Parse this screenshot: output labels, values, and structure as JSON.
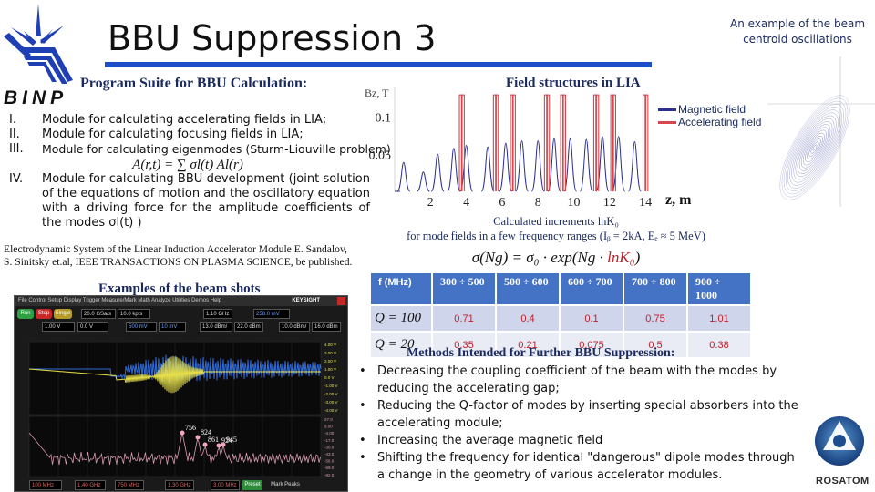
{
  "header": {
    "title": "BBU Suppression 3",
    "institute_logo_text": "BINP",
    "right_caption_line1": "An example of the beam",
    "right_caption_line2": "centroid oscillations",
    "accent_color": "#1f4fc8"
  },
  "program_suite": {
    "title": "Program Suite for BBU Calculation:",
    "modules": [
      {
        "num": "I.",
        "text": "Module for calculating accelerating fields in LIA;"
      },
      {
        "num": "II.",
        "text": "Module for calculating focusing fields in LIA;"
      },
      {
        "num": "III.",
        "text": "Module for calculating eigenmodes (Sturm-Liouville problem)",
        "formula": "A(r,t) = ∑ σl(t) Al(r)"
      },
      {
        "num": "IV.",
        "text": "Module for calculating BBU development (joint solution of the equations of motion and the oscillatory equation with a driving force for the amplitude coefficients of the modes σl(t) )"
      }
    ],
    "citation_line1": "Electrodynamic System of the Linear Induction Accelerator Module E. Sandalov,",
    "citation_line2": "S. Sinitsky et.al, IEEE TRANSACTIONS ON PLASMA SCIENCE, be  published."
  },
  "field_chart": {
    "title": "Field structures in LIA",
    "legend": [
      {
        "label": "Magnetic field",
        "color": "#2b2f8f"
      },
      {
        "label": "Accelerating field",
        "color": "#d9474e"
      }
    ]
  },
  "chart_data": {
    "type": "line",
    "title": "Field structures in LIA",
    "xlabel": "z, m",
    "ylabel": "Bz, T",
    "xlim": [
      0,
      14.5
    ],
    "ylim": [
      0,
      0.14
    ],
    "xticks": [
      2,
      4,
      6,
      8,
      10,
      12,
      14
    ],
    "yticks": [
      0.05,
      0.1
    ],
    "ytick_labels": [
      "0.05",
      "0.1"
    ],
    "legend_position": "right",
    "series": [
      {
        "name": "Magnetic field",
        "color": "#2b2f8f",
        "peaks_z": [
          0.5,
          1.6,
          2.4,
          3.3,
          4.0,
          5.2,
          6.2,
          7.1,
          8.0,
          8.9,
          9.8,
          10.7,
          11.6,
          12.5,
          13.4
        ],
        "peaks_B": [
          0.039,
          0.026,
          0.05,
          0.058,
          0.062,
          0.06,
          0.065,
          0.068,
          0.068,
          0.071,
          0.071,
          0.07,
          0.074,
          0.074,
          0.067
        ]
      },
      {
        "name": "Accelerating field",
        "color": "#d9474e",
        "pulse_pairs_z": [
          3.75,
          5.65,
          6.6,
          8.5,
          9.4,
          11.25,
          12.2,
          14.0
        ],
        "pulse_height": 0.13
      }
    ]
  },
  "increments": {
    "caption_line1": "Calculated increments lnK₀",
    "caption_line2": "for mode fields in a few frequency ranges (Iᵦ = 2kA, Eₑ ≈ 5 MeV)",
    "formula_prefix": "σ(Ng) = σ₀ · exp(Ng · ",
    "formula_red": "lnK₀",
    "formula_suffix": ")",
    "table": {
      "headers": [
        "f (MHz)",
        "300 ÷ 500",
        "500 ÷ 600",
        "600 ÷ 700",
        "700 ÷ 800",
        "900 ÷ 1000"
      ],
      "rows": [
        {
          "label": "Q = 100",
          "values": [
            "0.71",
            "0.4",
            "0.1",
            "0.75",
            "1.01"
          ]
        },
        {
          "label": "Q = 20",
          "values": [
            "0.35",
            "0.21",
            "0.075",
            "0.5",
            "0.38"
          ]
        }
      ]
    }
  },
  "beam_shots": {
    "title": "Examples of the beam shots",
    "scope": {
      "menu": "File  Control  Setup  Display  Trigger  Measure/Mark  Math  Analyze  Utilities  Demos  Help",
      "brand": "KEYSIGHT",
      "run_label": "Run",
      "stop_label": "Stop",
      "single_label": "Single",
      "sample_rate": "20.0 GSa/s",
      "memory": "10.0 kpts",
      "freq": "1.10 GHz",
      "trigger_level": "258.0 mV",
      "ch1_scale": "1.00 V",
      "ch1_offset": "0.0 V",
      "ch2_scale": "500 mV",
      "ch2_offset": "10 mV",
      "math1_scale": "13.0 dBm/",
      "math1_ref": "22.0 dBm",
      "math2_scale": "10.0 dBm/",
      "math2_ref": "16.0 dBm",
      "start": "100 MHz",
      "stop": "1.40 GHz",
      "cf": "750 MHz",
      "span": "1.30 GHz",
      "rbw": "3.00 MHz",
      "preset": "Preset",
      "mark_peaks": "Mark Peaks",
      "peak_labels": [
        "756",
        "824",
        "861",
        "924",
        "945"
      ],
      "volt_ticks": [
        "4.00 V",
        "3.00 V",
        "2.00 V",
        "1.00 V",
        "0.0 V",
        "-1.00 V",
        "-2.00 V",
        "-3.00 V",
        "-4.00 V"
      ],
      "db_ticks": [
        "27.0",
        "9.00",
        "-4.00",
        "-17.0",
        "-30.0",
        "-43.0",
        "-56.0",
        "-69.0",
        "-82.0"
      ]
    }
  },
  "methods": {
    "title": "Methods Intended for Further BBU Suppression:",
    "items": [
      "Decreasing the coupling coefficient of the beam with the modes by reducing the accelerating gap;",
      "Reducing the Q-factor of modes by inserting special absorbers into the accelerating module;",
      "Increasing the average magnetic field",
      "Shifting the frequency for identical \"dangerous\" dipole modes through a change in the geometry of various accelerator modules."
    ]
  },
  "footer": {
    "partner_logo_text": "ROSATOM"
  }
}
